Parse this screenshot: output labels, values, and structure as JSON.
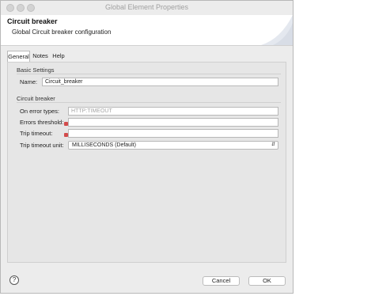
{
  "window": {
    "title": "Global Element Properties"
  },
  "header": {
    "title": "Circuit breaker",
    "subtitle": "Global Circuit breaker configuration"
  },
  "tabs": [
    {
      "label": "General",
      "active": true
    },
    {
      "label": "Notes",
      "active": false
    },
    {
      "label": "Help",
      "active": false
    }
  ],
  "basic_settings": {
    "section_label": "Basic Settings",
    "name_label": "Name:",
    "name_value": "Circuit_breaker"
  },
  "circuit_breaker": {
    "section_label": "Circuit breaker",
    "on_error_types_label": "On error types:",
    "on_error_types_placeholder": "HTTP:TIMEOUT",
    "errors_threshold_label": "Errors threshold:",
    "errors_threshold_value": "",
    "trip_timeout_label": "Trip timeout:",
    "trip_timeout_value": "",
    "trip_timeout_unit_label": "Trip timeout unit:",
    "trip_timeout_unit_value": "MILLISECONDS (Default)"
  },
  "footer": {
    "help_icon": "help-icon",
    "cancel_label": "Cancel",
    "ok_label": "OK"
  },
  "colors": {
    "error_marker": "#d24b4b",
    "dialog_bg": "#ececec"
  }
}
